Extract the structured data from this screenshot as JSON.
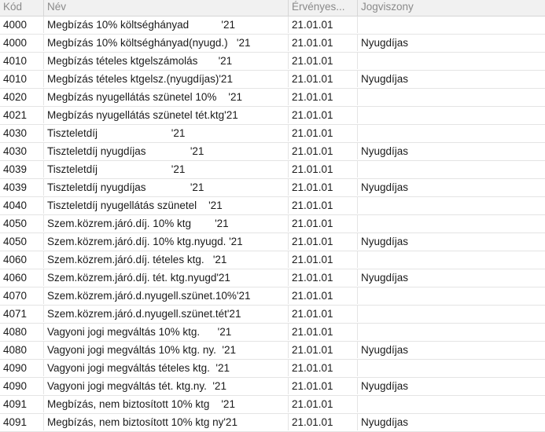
{
  "columns": {
    "code": "Kód",
    "name": "Név",
    "valid_from": "Érvényes...",
    "relationship": "Jogviszony"
  },
  "rows": [
    {
      "code": "4000",
      "name": "Megbízás 10% költséghányad           '21",
      "valid_from": "21.01.01",
      "relationship": ""
    },
    {
      "code": "4000",
      "name": "Megbízás 10% költséghányad(nyugd.)   '21",
      "valid_from": "21.01.01",
      "relationship": "Nyugdíjas"
    },
    {
      "code": "4010",
      "name": "Megbízás tételes ktgelszámolás       '21",
      "valid_from": "21.01.01",
      "relationship": ""
    },
    {
      "code": "4010",
      "name": "Megbízás tételes ktgelsz.(nyugdíjas)'21",
      "valid_from": "21.01.01",
      "relationship": "Nyugdíjas"
    },
    {
      "code": "4020",
      "name": "Megbízás nyugellátás szünetel 10%    '21",
      "valid_from": "21.01.01",
      "relationship": ""
    },
    {
      "code": "4021",
      "name": "Megbízás nyugellátás szünetel tét.ktg'21",
      "valid_from": "21.01.01",
      "relationship": ""
    },
    {
      "code": "4030",
      "name": "Tiszteletdíj                         '21",
      "valid_from": "21.01.01",
      "relationship": ""
    },
    {
      "code": "4030",
      "name": "Tiszteletdíj nyugdíjas               '21",
      "valid_from": "21.01.01",
      "relationship": "Nyugdíjas"
    },
    {
      "code": "4039",
      "name": "Tiszteletdíj                         '21",
      "valid_from": "21.01.01",
      "relationship": ""
    },
    {
      "code": "4039",
      "name": "Tiszteletdíj nyugdíjas               '21",
      "valid_from": "21.01.01",
      "relationship": "Nyugdíjas"
    },
    {
      "code": "4040",
      "name": "Tiszteletdíj nyugellátás szünetel    '21",
      "valid_from": "21.01.01",
      "relationship": ""
    },
    {
      "code": "4050",
      "name": "Szem.közrem.járó.díj. 10% ktg        '21",
      "valid_from": "21.01.01",
      "relationship": ""
    },
    {
      "code": "4050",
      "name": "Szem.közrem.járó.díj. 10% ktg.nyugd. '21",
      "valid_from": "21.01.01",
      "relationship": "Nyugdíjas"
    },
    {
      "code": "4060",
      "name": "Szem.közrem.járó.díj. tételes ktg.   '21",
      "valid_from": "21.01.01",
      "relationship": ""
    },
    {
      "code": "4060",
      "name": "Szem.közrem.járó.díj. tét. ktg.nyugd'21",
      "valid_from": "21.01.01",
      "relationship": "Nyugdíjas"
    },
    {
      "code": "4070",
      "name": "Szem.közrem.járó.d.nyugell.szünet.10%'21",
      "valid_from": "21.01.01",
      "relationship": ""
    },
    {
      "code": "4071",
      "name": "Szem.közrem.járó.d.nyugell.szünet.tét'21",
      "valid_from": "21.01.01",
      "relationship": ""
    },
    {
      "code": "4080",
      "name": "Vagyoni jogi megváltás 10% ktg.      '21",
      "valid_from": "21.01.01",
      "relationship": ""
    },
    {
      "code": "4080",
      "name": "Vagyoni jogi megváltás 10% ktg. ny.  '21",
      "valid_from": "21.01.01",
      "relationship": "Nyugdíjas"
    },
    {
      "code": "4090",
      "name": "Vagyoni jogi megváltás tételes ktg.  '21",
      "valid_from": "21.01.01",
      "relationship": ""
    },
    {
      "code": "4090",
      "name": "Vagyoni jogi megváltás tét. ktg.ny.  '21",
      "valid_from": "21.01.01",
      "relationship": "Nyugdíjas"
    },
    {
      "code": "4091",
      "name": "Megbízás, nem biztosított 10% ktg    '21",
      "valid_from": "21.01.01",
      "relationship": ""
    },
    {
      "code": "4091",
      "name": "Megbízás, nem biztosított 10% ktg ny'21",
      "valid_from": "21.01.01",
      "relationship": "Nyugdíjas"
    }
  ]
}
